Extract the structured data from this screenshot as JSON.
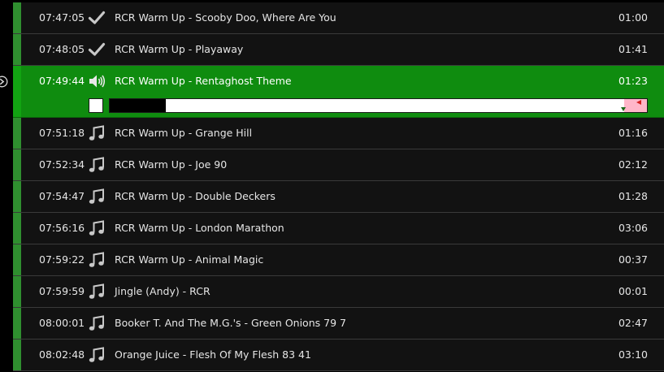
{
  "colors": {
    "background": "#000000",
    "row_background": "#121212",
    "row_divider": "#3a3a3a",
    "status_stripe": "#2f8f2f",
    "playing_background": "#0f8c0f",
    "text": "#e6e6e6",
    "icon": "#c8c8c8",
    "progress_played": "#000000",
    "progress_remaining": "#ffffff",
    "fade_zone": "#ffb6c9"
  },
  "playlist": {
    "items": [
      {
        "time": "07:47:05",
        "title": "RCR Warm Up - Scooby Doo, Where Are You",
        "duration": "01:00",
        "status": "played",
        "icon": "check-icon"
      },
      {
        "time": "07:48:05",
        "title": "RCR Warm Up - Playaway",
        "duration": "01:41",
        "status": "played",
        "icon": "check-icon"
      },
      {
        "time": "07:49:44",
        "title": "RCR Warm Up - Rentaghost Theme",
        "duration": "01:23",
        "status": "playing",
        "icon": "speaker-icon",
        "progress_fraction": 0.105
      },
      {
        "time": "07:51:18",
        "title": "RCR Warm Up - Grange Hill",
        "duration": "01:16",
        "status": "queued",
        "icon": "music-note-icon"
      },
      {
        "time": "07:52:34",
        "title": "RCR Warm Up - Joe 90",
        "duration": "02:12",
        "status": "queued",
        "icon": "music-note-icon"
      },
      {
        "time": "07:54:47",
        "title": "RCR Warm Up - Double Deckers",
        "duration": "01:28",
        "status": "queued",
        "icon": "music-note-icon"
      },
      {
        "time": "07:56:16",
        "title": "RCR Warm Up - London Marathon",
        "duration": "03:06",
        "status": "queued",
        "icon": "music-note-icon"
      },
      {
        "time": "07:59:22",
        "title": "RCR Warm Up - Animal Magic",
        "duration": "00:37",
        "status": "queued",
        "icon": "music-note-icon"
      },
      {
        "time": "07:59:59",
        "title": "Jingle (Andy) - RCR",
        "duration": "00:01",
        "status": "queued",
        "icon": "music-note-icon"
      },
      {
        "time": "08:00:01",
        "title": "Booker T. And The M.G.'s - Green Onions 79 7",
        "duration": "02:47",
        "status": "queued",
        "icon": "music-note-icon"
      },
      {
        "time": "08:02:48",
        "title": "Orange Juice - Flesh Of My Flesh 83 41",
        "duration": "03:10",
        "status": "queued",
        "icon": "music-note-icon"
      }
    ]
  },
  "sidebar": {
    "expand_icon": "arrow-right-circle-icon"
  }
}
